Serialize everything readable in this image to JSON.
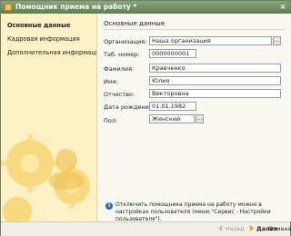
{
  "window": {
    "title": "Помощник приема на работу *",
    "close_symbol": "×"
  },
  "sidebar": {
    "items": [
      {
        "label": "Основные данные",
        "active": true
      },
      {
        "label": "Кадровая информация",
        "active": false
      },
      {
        "label": "Дополнительная информация",
        "active": false
      }
    ]
  },
  "form": {
    "section_title": "Основные данные",
    "fields": [
      {
        "label": "Организация:",
        "value": "Наша организация",
        "has_select": true
      },
      {
        "label": "Таб. номер:",
        "value": "0000000001",
        "has_select": false
      },
      {
        "label": "Фамилия:",
        "value": "Кравченко",
        "has_select": false
      },
      {
        "label": "Имя:",
        "value": "Юлия",
        "has_select": false
      },
      {
        "label": "Отчество:",
        "value": "Викторовна",
        "has_select": false
      },
      {
        "label": "Дата рождения:",
        "value": "01.01.1982",
        "has_select": false
      },
      {
        "label": "Пол:",
        "value": "Женский",
        "has_select": true
      }
    ],
    "select_symbol": "..."
  },
  "info": {
    "icon": "info-icon",
    "text": "Отключить помощника приема на работу можно в настройках пользователя (меню \"Сервис - Настройки пользователя\")."
  },
  "footer": {
    "back_label": "Назад",
    "next_label": "Далее",
    "cancel_label": "Отмена"
  },
  "colors": {
    "titlebar": "#6f8d62",
    "sidebar_bg": "#fbf1c5",
    "gear": "#f6d36a",
    "info_icon": "#2d6fb3",
    "next_arrow": "#e2a814"
  }
}
